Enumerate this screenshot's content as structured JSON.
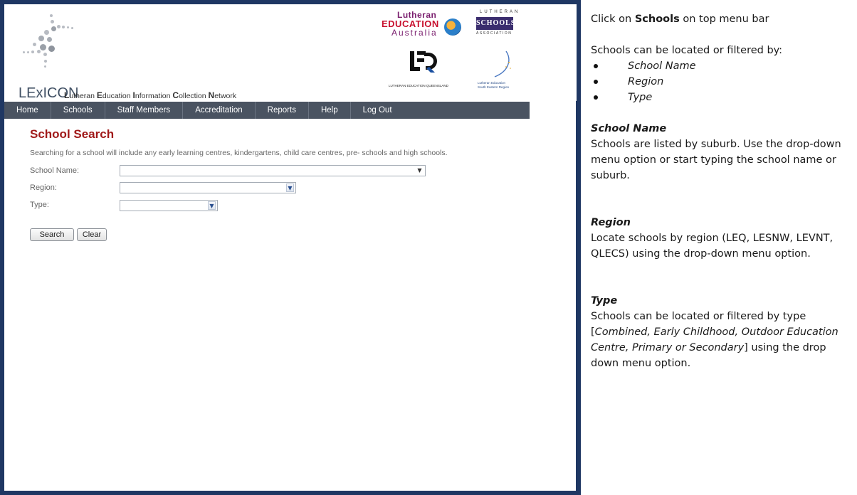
{
  "header": {
    "brand": "LExICON",
    "tagline_parts": [
      {
        "cap": "L",
        "rest": "utheran "
      },
      {
        "cap": "E",
        "rest": "ducation "
      },
      {
        "cap": "I",
        "rest": "nformation "
      },
      {
        "cap": "C",
        "rest": "ollection "
      },
      {
        "cap": "N",
        "rest": "etwork"
      }
    ],
    "logos": {
      "lea": {
        "line1": "Lutheran",
        "line2": "EDUCATION",
        "line3": "Australia"
      },
      "lsa": {
        "top": "LUTHERAN",
        "mid": "SCHOOLS",
        "bottom": "ASSOCIATION"
      },
      "leq": {
        "text": "LUTHERAN EDUCATION QUEENSLAND"
      },
      "les": {
        "line1": "Lutheran Education",
        "line2": "South Eastern Region"
      }
    }
  },
  "nav": {
    "items": [
      "Home",
      "Schools",
      "Staff Members",
      "Accreditation",
      "Reports",
      "Help",
      "Log Out"
    ]
  },
  "search": {
    "title": "School Search",
    "intro": "Searching for a school will include any early learning centres, kindergartens, child care centres, pre- schools and high schools.",
    "fields": {
      "school_name": {
        "label": "School Name:",
        "value": ""
      },
      "region": {
        "label": "Region:",
        "value": ""
      },
      "type": {
        "label": "Type:",
        "value": ""
      }
    },
    "buttons": {
      "search": "Search",
      "clear": "Clear"
    }
  },
  "instructions": {
    "line1_pre": "Click on ",
    "line1_bold": "Schools",
    "line1_post": " on top menu bar",
    "line2": "Schools can be located or filtered by:",
    "bullets": [
      "School Name",
      "Region",
      "Type"
    ],
    "school_name_heading": "School Name",
    "school_name_text": "Schools are listed by suburb. Use the drop-down menu option or start typing the school name or suburb.",
    "region_heading": "Region",
    "region_text": "Locate schools by region (LEQ, LESNW, LEVNT, QLECS) using the drop-down menu option.",
    "type_heading": "Type",
    "type_text_pre": "Schools can be located or filtered by type [",
    "type_text_italic": "Combined, Early Childhood, Outdoor Education Centre, Primary or Secondary",
    "type_text_post": "] using the drop down menu option."
  }
}
